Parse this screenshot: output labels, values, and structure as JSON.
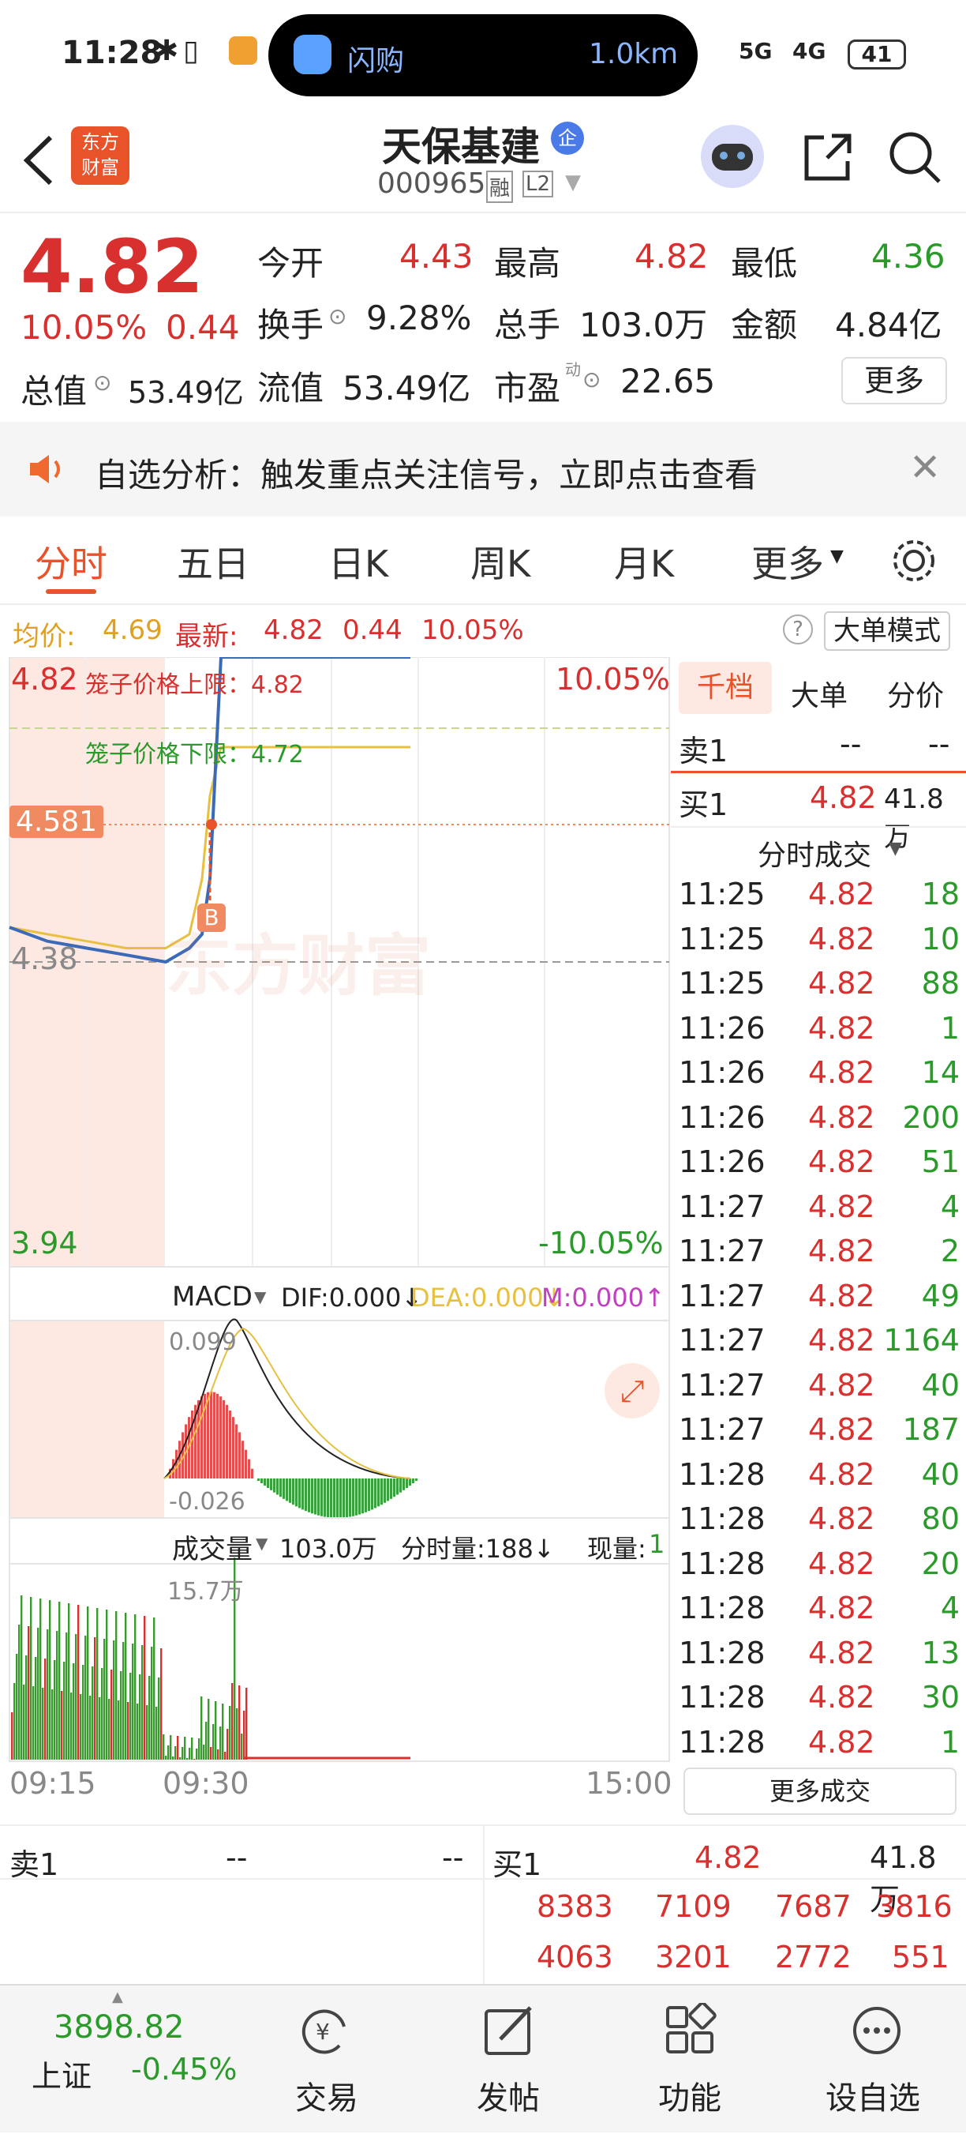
{
  "status_bar": {
    "time": "11:28",
    "island_app": "闪购",
    "island_distance": "1.0km",
    "network1": "5G",
    "network2": "4G",
    "battery": "41"
  },
  "header": {
    "title": "天保基建",
    "code": "000965",
    "badge_rong": "融",
    "badge_l2": "L2",
    "logo_text1": "东方",
    "logo_text2": "财富",
    "tag": "企"
  },
  "quote": {
    "price": "4.82",
    "change_pct": "10.05%",
    "change": "0.44",
    "open_label": "今开",
    "open": "4.43",
    "high_label": "最高",
    "high": "4.82",
    "low_label": "最低",
    "low": "4.36",
    "turnover_label": "换手",
    "turnover": "9.28%",
    "volume_label": "总手",
    "volume": "103.0万",
    "amount_label": "金额",
    "amount": "4.84亿",
    "mktcap_label": "总值",
    "mktcap": "53.49亿",
    "float_label": "流值",
    "float": "53.49亿",
    "pe_label": "市盈",
    "pe_sup": "动",
    "pe": "22.65",
    "more_label": "更多"
  },
  "notice": {
    "text": "自选分析：触发重点关注信号，立即点击查看"
  },
  "tabs": [
    "分时",
    "五日",
    "日K",
    "周K",
    "月K",
    "更多"
  ],
  "avg_row": {
    "avg_label": "均价:",
    "avg": "4.69",
    "latest_label": "最新:",
    "latest": "4.82",
    "chg": "0.44",
    "pct": "10.05%",
    "mode_label": "大单模式",
    "help": "?"
  },
  "chart": {
    "top_price": "4.82",
    "top_pct": "10.05%",
    "bottom_price": "3.94",
    "bottom_pct": "-10.05%",
    "mid_price": "4.38",
    "cursor_price": "4.581",
    "cage_upper": "笼子价格上限：4.82",
    "cage_lower": "笼子价格下限：4.72",
    "watermark": "东方财富",
    "b_marker": "B",
    "macd_label": "MACD",
    "dif": "DIF:0.000↓",
    "dea": "DEA:0.000↓",
    "m": "M:0.000↑",
    "macd_top": "0.099",
    "macd_bottom": "-0.026",
    "vol_label": "成交量",
    "vol_total": "103.0万",
    "vol_fen": "分时量:188↓",
    "vol_now_label": "现量:",
    "vol_now": "1",
    "vol_max": "15.7万",
    "time_start": "09:15",
    "time_mid": "09:30",
    "time_end": "15:00"
  },
  "chart_data": {
    "type": "line",
    "x": [
      "09:15",
      "09:30",
      "15:00"
    ],
    "ylim": [
      3.94,
      4.82
    ],
    "series": [
      {
        "name": "最新",
        "values": [
          4.43,
          4.41,
          4.4,
          4.39,
          4.38,
          4.4,
          4.42,
          4.5,
          4.82,
          4.82
        ]
      },
      {
        "name": "均价",
        "values": [
          4.43,
          4.42,
          4.41,
          4.4,
          4.4,
          4.42,
          4.5,
          4.62,
          4.69,
          4.69
        ]
      }
    ]
  },
  "right_panel": {
    "tabs": [
      "千档",
      "大单",
      "分价"
    ],
    "sell1_label": "卖1",
    "sell1_price": "--",
    "sell1_vol": "--",
    "buy1_label": "买1",
    "buy1_price": "4.82",
    "buy1_vol": "41.8万",
    "trades_title": "分时成交",
    "more_trades": "更多成交",
    "trades": [
      [
        "11:25",
        "4.82",
        "18"
      ],
      [
        "11:25",
        "4.82",
        "10"
      ],
      [
        "11:25",
        "4.82",
        "88"
      ],
      [
        "11:26",
        "4.82",
        "1"
      ],
      [
        "11:26",
        "4.82",
        "14"
      ],
      [
        "11:26",
        "4.82",
        "200"
      ],
      [
        "11:26",
        "4.82",
        "51"
      ],
      [
        "11:27",
        "4.82",
        "4"
      ],
      [
        "11:27",
        "4.82",
        "2"
      ],
      [
        "11:27",
        "4.82",
        "49"
      ],
      [
        "11:27",
        "4.82",
        "1164"
      ],
      [
        "11:27",
        "4.82",
        "40"
      ],
      [
        "11:27",
        "4.82",
        "187"
      ],
      [
        "11:28",
        "4.82",
        "40"
      ],
      [
        "11:28",
        "4.82",
        "80"
      ],
      [
        "11:28",
        "4.82",
        "20"
      ],
      [
        "11:28",
        "4.82",
        "4"
      ],
      [
        "11:28",
        "4.82",
        "13"
      ],
      [
        "11:28",
        "4.82",
        "30"
      ],
      [
        "11:28",
        "4.82",
        "1"
      ]
    ]
  },
  "bottom_quote": {
    "sell1_label": "卖1",
    "sell1_price": "--",
    "sell1_vol": "--",
    "buy1_label": "买1",
    "buy1_price": "4.82",
    "buy1_vol": "41.8万",
    "queue_row1": [
      "8383",
      "7109",
      "7687",
      "3816"
    ],
    "queue_row2": [
      "4063",
      "3201",
      "2772",
      "551"
    ]
  },
  "footer": {
    "index_value": "3898.82",
    "index_name": "上证",
    "index_pct": "-0.45%",
    "trade": "交易",
    "post": "发帖",
    "function": "功能",
    "watchlist": "设自选"
  }
}
